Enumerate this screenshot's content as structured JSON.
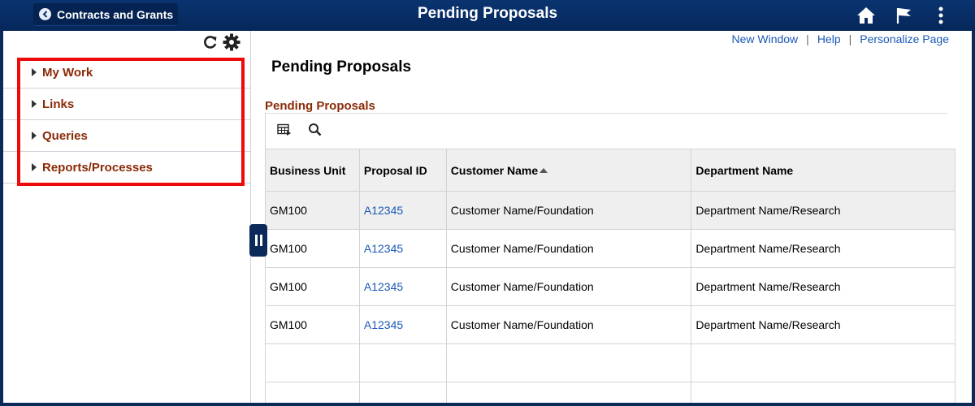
{
  "header": {
    "back_label": "Contracts and Grants",
    "title": "Pending Proposals",
    "icons": [
      "home-icon",
      "flag-icon",
      "more-vert-icon"
    ]
  },
  "left_panel": {
    "tool_icons": [
      "refresh-icon",
      "gear-icon"
    ],
    "items": [
      {
        "label": "My Work"
      },
      {
        "label": "Links"
      },
      {
        "label": "Queries"
      },
      {
        "label": "Reports/Processes"
      }
    ]
  },
  "top_links": {
    "new_window": "New Window",
    "help": "Help",
    "personalize": "Personalize Page",
    "separator": "|"
  },
  "main": {
    "page_heading": "Pending Proposals",
    "grid_title": "Pending Proposals",
    "toolbar_icons": [
      "grid-settings-icon",
      "search-icon"
    ]
  },
  "grid": {
    "columns": [
      "Business Unit",
      "Proposal ID",
      "Customer Name",
      "Department Name"
    ],
    "sorted_column": "Customer Name",
    "rows": [
      {
        "bu": "GM100",
        "id": "A12345",
        "customer": "Customer Name/Foundation",
        "dept": "Department Name/Research"
      },
      {
        "bu": "GM100",
        "id": "A12345",
        "customer": "Customer Name/Foundation",
        "dept": "Department Name/Research"
      },
      {
        "bu": "GM100",
        "id": "A12345",
        "customer": "Customer Name/Foundation",
        "dept": "Department Name/Research"
      },
      {
        "bu": "GM100",
        "id": "A12345",
        "customer": "Customer Name/Foundation",
        "dept": "Department Name/Research"
      }
    ]
  },
  "colors": {
    "header_bg": "#0a3470",
    "accent_label": "#8a2a06",
    "link": "#1a58b8",
    "highlight_box": "#ee0a0a"
  }
}
